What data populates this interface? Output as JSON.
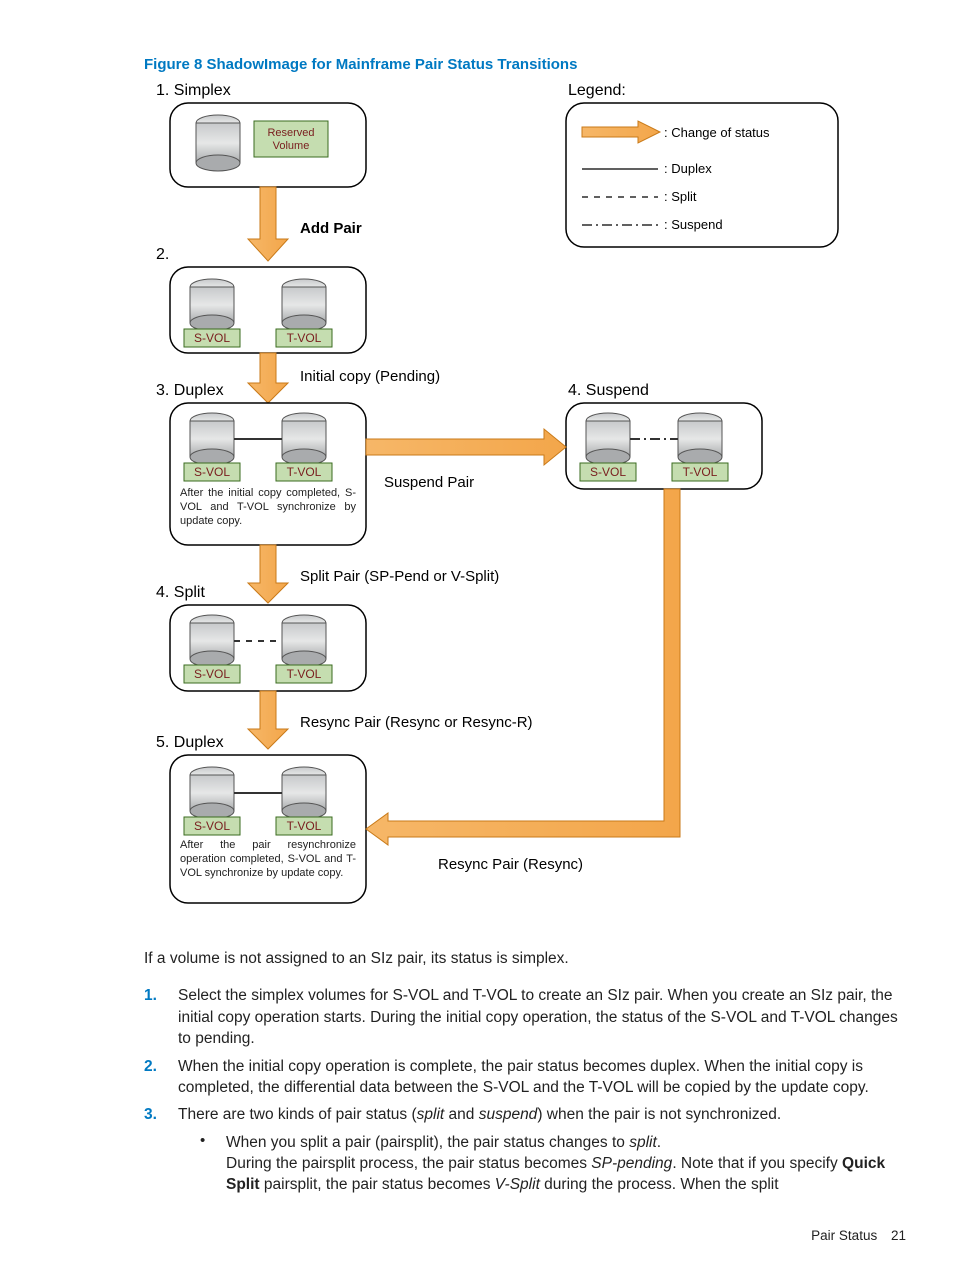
{
  "figure_caption": "Figure 8 ShadowImage for Mainframe Pair Status Transitions",
  "diagram": {
    "states": {
      "s1": "1. Simplex",
      "s2": "2.",
      "s3": "3. Duplex",
      "s4_split": "4. Split",
      "s4_susp_header": "4. Suspend",
      "s5": "5. Duplex"
    },
    "labels": {
      "reserved": "Reserved\nVolume",
      "svol": "S-VOL",
      "tvol": "T-VOL",
      "add_pair": "Add Pair",
      "initial_copy": "Initial copy (Pending)",
      "suspend_pair": "Suspend Pair",
      "split_pair": "Split Pair (SP-Pend or V-Split)",
      "resync_rr": "Resync Pair (Resync or Resync-R)",
      "resync": "Resync Pair (Resync)",
      "legend_title": "Legend:",
      "legend_change": ": Change of status",
      "legend_duplex": ": Duplex",
      "legend_split": ": Split",
      "legend_suspend": ": Suspend",
      "note3": "After the initial copy completed, S-VOL and T-VOL synchronize by update copy.",
      "note5": "After the pair resynchronize operation completed, S-VOL and T-VOL synchronize by update copy."
    }
  },
  "intro": "If a volume is not assigned to an SIz pair, its status is simplex.",
  "steps": [
    {
      "num": "1.",
      "text": "Select the simplex volumes for S-VOL and T-VOL to create an SIz pair. When you create an SIz pair, the initial copy operation starts. During the initial copy operation, the status of the S-VOL and T-VOL changes to pending."
    },
    {
      "num": "2.",
      "text": "When the initial copy operation is complete, the pair status becomes duplex. When the initial copy is completed, the differential data between the S-VOL and the T-VOL will be copied by the update copy."
    },
    {
      "num": "3.",
      "text_html": "There are two kinds of pair status (<em>split</em> and <em>suspend</em>) when the pair is not synchronized."
    }
  ],
  "sub": [
    {
      "bullet": "•",
      "lines_html": [
        "When you split a pair (pairsplit), the pair status changes to <em>split</em>.",
        "During the pairsplit process, the pair status becomes <em>SP-pending</em>. Note that if you specify <b>Quick Split</b> pairsplit, the pair status becomes <em>V-Split</em> during the process. When the split"
      ]
    }
  ],
  "footer": {
    "section": "Pair Status",
    "page": "21"
  }
}
